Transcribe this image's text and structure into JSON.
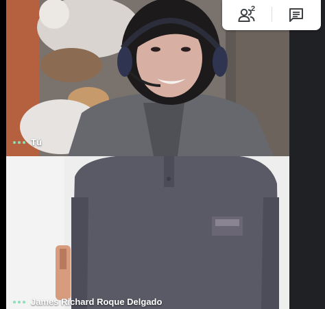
{
  "toolbar": {
    "people_icon": "people-icon",
    "people_count": "2",
    "chat_icon": "chat-icon"
  },
  "tiles": [
    {
      "name": "Tú",
      "status_icon": "audio-dots-icon",
      "accent": "#8ae0b8"
    },
    {
      "name": "James Richard Roque Delgado",
      "status_icon": "audio-dots-icon",
      "accent": "#8ae0b8"
    }
  ]
}
